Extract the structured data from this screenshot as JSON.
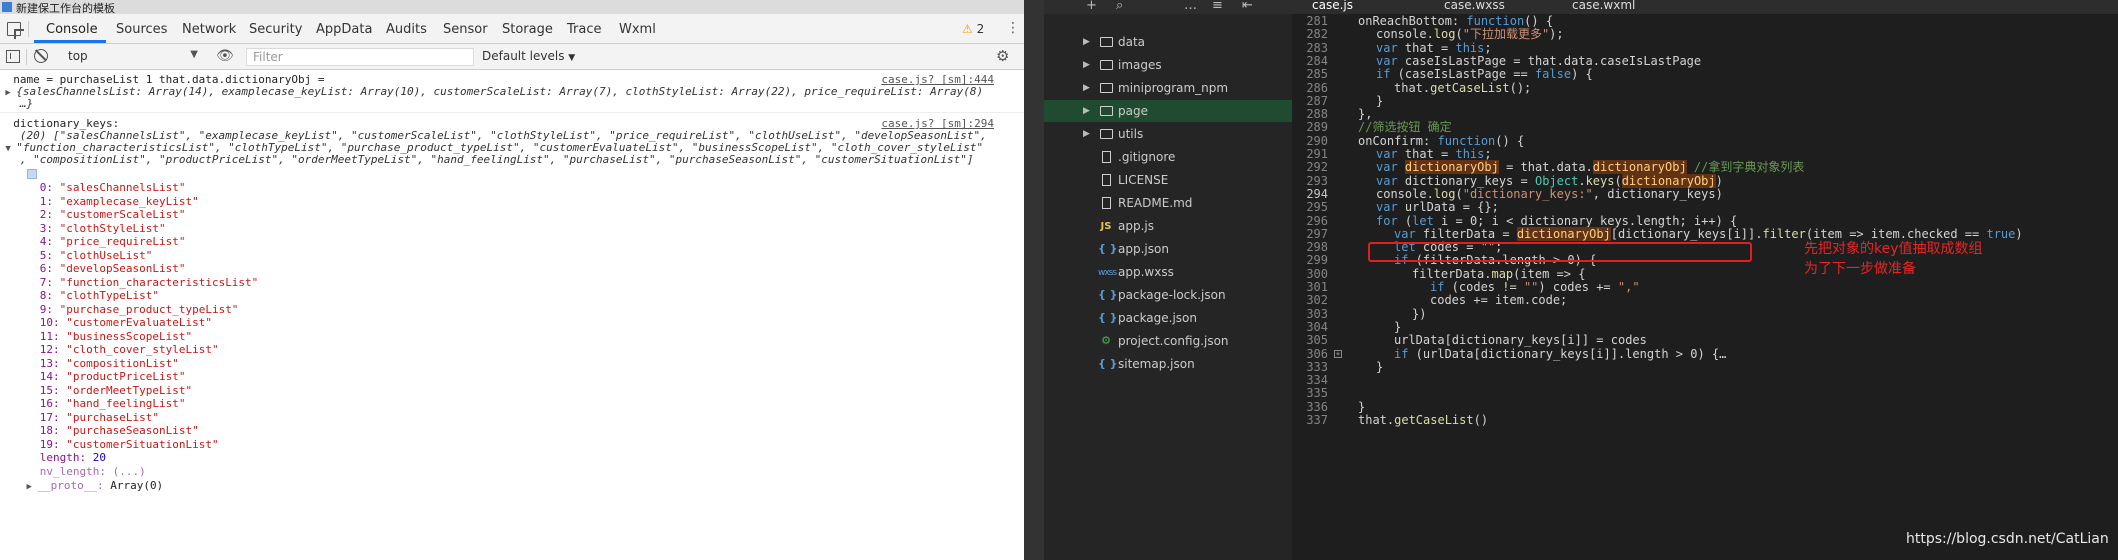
{
  "window": {
    "title": "新建保工作台的模板"
  },
  "devtools": {
    "tabs": [
      "Console",
      "Sources",
      "Network",
      "Security",
      "AppData",
      "Audits",
      "Sensor",
      "Storage",
      "Trace",
      "Wxml"
    ],
    "active_tab": "Console",
    "warnings_count": "2",
    "context": "top",
    "filter_placeholder": "Filter",
    "levels": "Default levels"
  },
  "console": {
    "msg1": {
      "text": "name = purchaseList 1 that.data.dictionaryObj =",
      "source": "case.js? [sm]:444",
      "detail": "{salesChannelsList: Array(14), examplecase_keyList: Array(10), customerScaleList: Array(7), clothStyleList: Array(22), price_requireList: Array(8)",
      "ellipsis": "…}"
    },
    "msg2": {
      "text": "dictionary_keys:",
      "source": "case.js? [sm]:294",
      "summary": [
        "(20) [\"salesChannelsList\", \"examplecase_keyList\", \"customerScaleList\", \"clothStyleList\", \"price_requireList\", \"clothUseList\", \"developSeasonList\",",
        "\"function_characteristicsList\", \"clothTypeList\", \"purchase_product_typeList\", \"customerEvaluateList\", \"businessScopeList\", \"cloth_cover_styleList\"",
        ", \"compositionList\", \"productPriceList\", \"orderMeetTypeList\", \"hand_feelingList\", \"purchaseList\", \"purchaseSeasonList\", \"customerSituationList\"]"
      ],
      "items": [
        {
          "index": "0:",
          "value": "\"salesChannelsList\""
        },
        {
          "index": "1:",
          "value": "\"examplecase_keyList\""
        },
        {
          "index": "2:",
          "value": "\"customerScaleList\""
        },
        {
          "index": "3:",
          "value": "\"clothStyleList\""
        },
        {
          "index": "4:",
          "value": "\"price_requireList\""
        },
        {
          "index": "5:",
          "value": "\"clothUseList\""
        },
        {
          "index": "6:",
          "value": "\"developSeasonList\""
        },
        {
          "index": "7:",
          "value": "\"function_characteristicsList\""
        },
        {
          "index": "8:",
          "value": "\"clothTypeList\""
        },
        {
          "index": "9:",
          "value": "\"purchase_product_typeList\""
        },
        {
          "index": "10:",
          "value": "\"customerEvaluateList\""
        },
        {
          "index": "11:",
          "value": "\"businessScopeList\""
        },
        {
          "index": "12:",
          "value": "\"cloth_cover_styleList\""
        },
        {
          "index": "13:",
          "value": "\"compositionList\""
        },
        {
          "index": "14:",
          "value": "\"productPriceList\""
        },
        {
          "index": "15:",
          "value": "\"orderMeetTypeList\""
        },
        {
          "index": "16:",
          "value": "\"hand_feelingList\""
        },
        {
          "index": "17:",
          "value": "\"purchaseList\""
        },
        {
          "index": "18:",
          "value": "\"purchaseSeasonList\""
        },
        {
          "index": "19:",
          "value": "\"customerSituationList\""
        }
      ],
      "length_key": "length:",
      "length_value": "20",
      "nv_length": "nv_length: (...)",
      "proto_key": "__proto__:",
      "proto_value": "Array(0)"
    }
  },
  "editor": {
    "tabs": [
      "case.js",
      "case.wxss",
      "case.wxml"
    ],
    "active_tab": "case.js",
    "explorer": [
      {
        "name": "data",
        "type": "folder"
      },
      {
        "name": "images",
        "type": "folder"
      },
      {
        "name": "miniprogram_npm",
        "type": "folder"
      },
      {
        "name": "page",
        "type": "folder"
      },
      {
        "name": "utils",
        "type": "folder"
      },
      {
        "name": ".gitignore",
        "type": "file"
      },
      {
        "name": "LICENSE",
        "type": "file"
      },
      {
        "name": "README.md",
        "type": "file"
      },
      {
        "name": "app.js",
        "type": "js"
      },
      {
        "name": "app.json",
        "type": "json"
      },
      {
        "name": "app.wxss",
        "type": "wxss"
      },
      {
        "name": "package-lock.json",
        "type": "json"
      },
      {
        "name": "package.json",
        "type": "json"
      },
      {
        "name": "project.config.json",
        "type": "config"
      },
      {
        "name": "sitemap.json",
        "type": "json"
      }
    ],
    "selected_item": "page",
    "code_lines": [
      {
        "no": "281",
        "text": "onReachBottom: function() {"
      },
      {
        "no": "282",
        "text": "console.log(\"下拉加载更多\");"
      },
      {
        "no": "283",
        "text": "var that = this;"
      },
      {
        "no": "284",
        "text": "var caseIsLastPage = that.data.caseIsLastPage"
      },
      {
        "no": "285",
        "text": "if (caseIsLastPage == false) {"
      },
      {
        "no": "286",
        "text": "that.getCaseList();"
      },
      {
        "no": "287",
        "text": "}"
      },
      {
        "no": "288",
        "text": "},"
      },
      {
        "no": "289",
        "text": "//筛选按钮 确定"
      },
      {
        "no": "290",
        "text": "onConfirm: function() {"
      },
      {
        "no": "291",
        "text": "var that = this;"
      },
      {
        "no": "292",
        "text": "var dictionaryObj = that.data.dictionaryObj //拿到字典对象列表"
      },
      {
        "no": "293",
        "text": "var dictionary_keys = Object.keys(dictionaryObj)"
      },
      {
        "no": "294",
        "text": "console.log(\"dictionary_keys:\", dictionary_keys)"
      },
      {
        "no": "295",
        "text": "var urlData = {};"
      },
      {
        "no": "296",
        "text": "for (let i = 0; i < dictionary_keys.length; i++) {"
      },
      {
        "no": "297",
        "text": "var filterData = dictionaryObj[dictionary_keys[i]].filter(item => item.checked == true)"
      },
      {
        "no": "298",
        "text": "let codes = \"\";"
      },
      {
        "no": "299",
        "text": "if (filterData.length > 0) {"
      },
      {
        "no": "300",
        "text": "filterData.map(item => {"
      },
      {
        "no": "301",
        "text": "if (codes != \"\") codes += \",\""
      },
      {
        "no": "302",
        "text": "codes += item.code;"
      },
      {
        "no": "303",
        "text": "})"
      },
      {
        "no": "304",
        "text": "}"
      },
      {
        "no": "305",
        "text": "urlData[dictionary_keys[i]] = codes"
      },
      {
        "no": "306",
        "text": "if (urlData[dictionary_keys[i]].length > 0) {…"
      },
      {
        "no": "333",
        "text": "}"
      },
      {
        "no": "334",
        "text": ""
      },
      {
        "no": "335",
        "text": ""
      },
      {
        "no": "336",
        "text": "}"
      },
      {
        "no": "337",
        "text": "that.getCaseList()"
      }
    ],
    "current_line": "294"
  },
  "annotation": {
    "line1": "先把对象的key值抽取成数组",
    "line2": "为了下一步做准备",
    "color": "#e82424"
  },
  "watermark": "https://blog.csdn.net/CatLian",
  "colors": {
    "accent": "#1a73e8",
    "editor_bg": "#1e1e1e",
    "sidebar_bg": "#252526",
    "selection": "#1f4b30"
  }
}
